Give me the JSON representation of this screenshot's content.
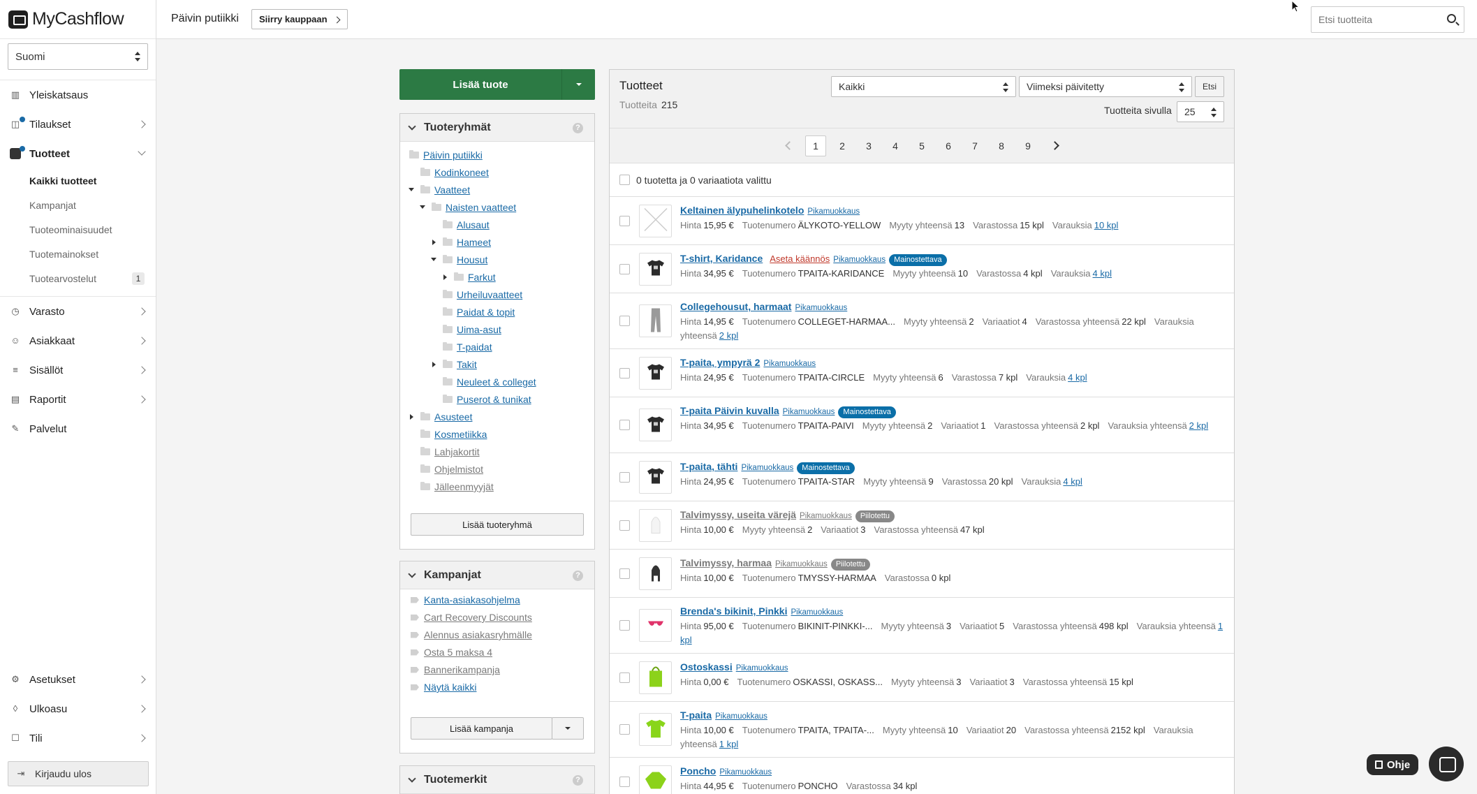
{
  "brand": "MyCashflow",
  "language": "Suomi",
  "nav": {
    "items": [
      {
        "label": "Yleiskatsaus",
        "icon": "chart-icon"
      },
      {
        "label": "Tilaukset",
        "icon": "bag-icon"
      },
      {
        "label": "Tuotteet",
        "icon": "product-icon"
      }
    ],
    "sub": [
      {
        "label": "Kaikki tuotteet"
      },
      {
        "label": "Kampanjat"
      },
      {
        "label": "Tuoteominaisuudet"
      },
      {
        "label": "Tuotemainokset"
      },
      {
        "label": "Tuotearvostelut",
        "count": "1"
      }
    ],
    "items2": [
      {
        "label": "Varasto"
      },
      {
        "label": "Asiakkaat"
      },
      {
        "label": "Sisällöt"
      },
      {
        "label": "Raportit"
      },
      {
        "label": "Palvelut"
      }
    ],
    "bottom": [
      {
        "label": "Asetukset"
      },
      {
        "label": "Ulkoasu"
      },
      {
        "label": "Tili"
      }
    ],
    "logout": "Kirjaudu ulos"
  },
  "topbar": {
    "shop": "Päivin putiikki",
    "goto": "Siirry kauppaan",
    "search_placeholder": "Etsi tuotteita"
  },
  "left": {
    "add_product": "Lisää tuote",
    "groups_title": "Tuoteryhmät",
    "groups": [
      {
        "label": "Päivin putiikki"
      },
      {
        "label": "Kodinkoneet"
      },
      {
        "label": "Vaatteet"
      },
      {
        "label": "Naisten vaatteet"
      },
      {
        "label": "Alusaut"
      },
      {
        "label": "Hameet"
      },
      {
        "label": "Housut"
      },
      {
        "label": "Farkut"
      },
      {
        "label": "Urheiluvaatteet"
      },
      {
        "label": "Paidat & topit"
      },
      {
        "label": "Uima-asut"
      },
      {
        "label": "T-paidat"
      },
      {
        "label": "Takit"
      },
      {
        "label": "Neuleet & colleget"
      },
      {
        "label": "Puserot & tunikat"
      },
      {
        "label": "Asusteet"
      },
      {
        "label": "Kosmetiikka"
      },
      {
        "label": "Lahjakortit"
      },
      {
        "label": "Ohjelmistot"
      },
      {
        "label": "Jälleenmyyjät"
      }
    ],
    "add_group": "Lisää tuoteryhmä",
    "campaigns_title": "Kampanjat",
    "campaigns": [
      {
        "label": "Kanta-asiakasohjelma"
      },
      {
        "label": "Cart Recovery Discounts"
      },
      {
        "label": "Alennus asiakasryhmälle"
      },
      {
        "label": "Osta 5 maksa 4"
      },
      {
        "label": "Bannerikampanja"
      },
      {
        "label": "Näytä kaikki"
      }
    ],
    "add_campaign": "Lisää kampanja",
    "brands_title": "Tuotemerkit",
    "help": "?"
  },
  "products": {
    "title": "Tuotteet",
    "count_label": "Tuotteita",
    "count": "215",
    "filter": "Kaikki",
    "sort": "Viimeksi päivitetty",
    "search_btn": "Etsi",
    "per_page_label": "Tuotteita sivulla",
    "per_page": "25",
    "pages": [
      "1",
      "2",
      "3",
      "4",
      "5",
      "6",
      "7",
      "8",
      "9"
    ],
    "selected_text": "0 tuotetta ja 0 variaatiota valittu",
    "quick_edit": "Pikamuokkaus",
    "set_translations": "Aseta käännös",
    "badge_promo": "Mainostettava",
    "badge_hidden": "Piilotettu",
    "lbl_price": "Hinta",
    "lbl_sku": "Tuotenumero",
    "lbl_sold": "Myyty yhteensä",
    "lbl_stock": "Varastossa",
    "lbl_stock_total": "Varastossa yhteensä",
    "lbl_res": "Varauksia",
    "lbl_res_total": "Varauksia yhteensä",
    "lbl_variants": "Variaatiot",
    "rows": [
      {
        "name": "Keltainen älypuhelinkotelo",
        "price": "15,95 €",
        "sku": "ÄLYKOTO-YELLOW",
        "sold": "13",
        "stock": "15 kpl",
        "res": "10 kpl",
        "thumb": "none-icon"
      },
      {
        "name": "T-shirt, Karidance",
        "price": "34,95 €",
        "sku": "TPAITA-KARIDANCE",
        "sold": "10",
        "stock": "4 kpl",
        "res": "4 kpl",
        "thumb": "tshirt-dark-icon"
      },
      {
        "name": "Collegehousut, harmaat",
        "price": "14,95 €",
        "sku": "COLLEGET-HARMAA...",
        "sold": "2",
        "variants": "4",
        "stock_total": "22 kpl",
        "res_total": "2 kpl",
        "thumb": "pants-icon"
      },
      {
        "name": "T-paita, ympyrä 2",
        "price": "24,95 €",
        "sku": "TPAITA-CIRCLE",
        "sold": "6",
        "stock": "7 kpl",
        "res": "4 kpl",
        "thumb": "tshirt-dark-icon"
      },
      {
        "name": "T-paita Päivin kuvalla",
        "price": "34,95 €",
        "sku": "TPAITA-PAIVI",
        "sold": "2",
        "variants": "1",
        "stock_total": "2 kpl",
        "res_total": "2 kpl",
        "thumb": "tshirt-dark-icon"
      },
      {
        "name": "T-paita, tähti",
        "price": "24,95 €",
        "sku": "TPAITA-STAR",
        "sold": "9",
        "stock": "20 kpl",
        "res": "4 kpl",
        "thumb": "tshirt-dark-icon"
      },
      {
        "name": "Talvimyssy, useita värejä",
        "price": "10,00 €",
        "sold": "2",
        "variants": "3",
        "stock_total": "47 kpl",
        "thumb": "beanie-light-icon"
      },
      {
        "name": "Talvimyssy, harmaa",
        "price": "10,00 €",
        "sku": "TMYSSY-HARMAA",
        "stock": "0 kpl",
        "thumb": "beanie-dark-icon"
      },
      {
        "name": "Brenda's bikinit, Pinkki",
        "price": "95,00 €",
        "sku": "BIKINIT-PINKKI-...",
        "sold": "3",
        "variants": "5",
        "stock_total": "498 kpl",
        "res_total": "1 kpl",
        "thumb": "bikini-icon"
      },
      {
        "name": "Ostoskassi",
        "price": "0,00 €",
        "sku": "OSKASSI, OSKASS...",
        "sold": "3",
        "variants": "3",
        "stock_total": "15 kpl",
        "thumb": "bag-green-icon"
      },
      {
        "name": "T-paita",
        "price": "10,00 €",
        "sku": "TPAITA, TPAITA-...",
        "sold": "10",
        "variants": "20",
        "stock_total": "2152 kpl",
        "res_total": "1 kpl",
        "thumb": "tshirt-green-icon"
      },
      {
        "name": "Poncho",
        "price": "44,95 €",
        "sku": "PONCHO",
        "stock": "34 kpl",
        "thumb": "poncho-icon"
      }
    ]
  },
  "float": {
    "help": "Ohje"
  }
}
